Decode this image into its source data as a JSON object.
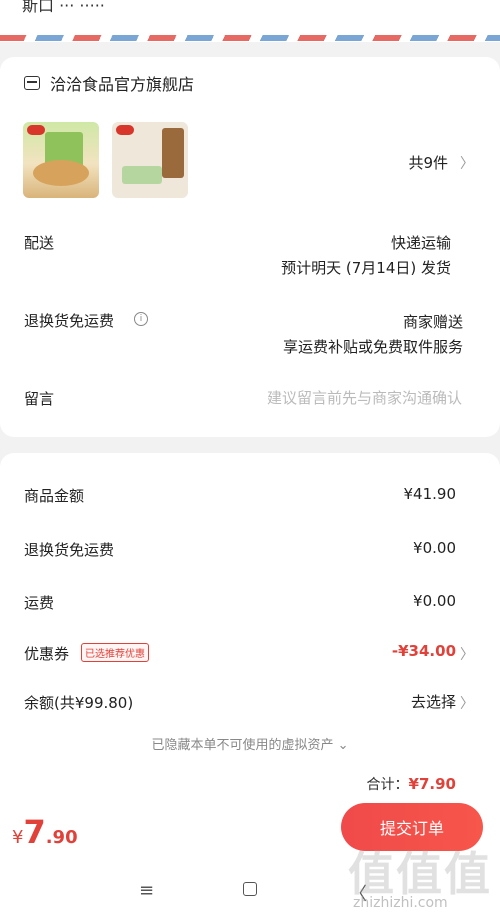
{
  "top": {
    "partial_text": "斯口 ··· ·····"
  },
  "store": {
    "name": "洽洽食品官方旗舰店",
    "item_count": "共9件"
  },
  "delivery": {
    "label": "配送",
    "method": "快递运输",
    "eta": "预计明天 (7月14日) 发货"
  },
  "return_shipping": {
    "label": "退换货免运费",
    "value_line1": "商家赠送",
    "value_line2": "享运费补贴或免费取件服务"
  },
  "message": {
    "label": "留言",
    "placeholder": "建议留言前先与商家沟通确认"
  },
  "summary": {
    "goods_amount_label": "商品金额",
    "goods_amount": "¥41.90",
    "return_fee_label": "退换货免运费",
    "return_fee": "¥0.00",
    "shipping_label": "运费",
    "shipping": "¥0.00",
    "coupon_label": "优惠券",
    "coupon_tag": "已选推荐优惠",
    "coupon_value": "-¥34.00",
    "balance_label": "余额(共¥99.80)",
    "balance_action": "去选择",
    "hidden_note": "已隐藏本单不可使用的虚拟资产",
    "total_label": "合计：",
    "total_value": "¥7.90"
  },
  "bottom": {
    "currency": "¥",
    "price_int": "7",
    "price_dec": ".90",
    "submit_label": "提交订单"
  },
  "nav": {
    "menu_icon": "≡",
    "back_icon": "〈"
  },
  "watermark": {
    "main": "值值值",
    "sub": "zhizhizhi.com"
  },
  "colors": {
    "accent": "#e0423a",
    "submit_gradient_start": "#f04a4a"
  }
}
